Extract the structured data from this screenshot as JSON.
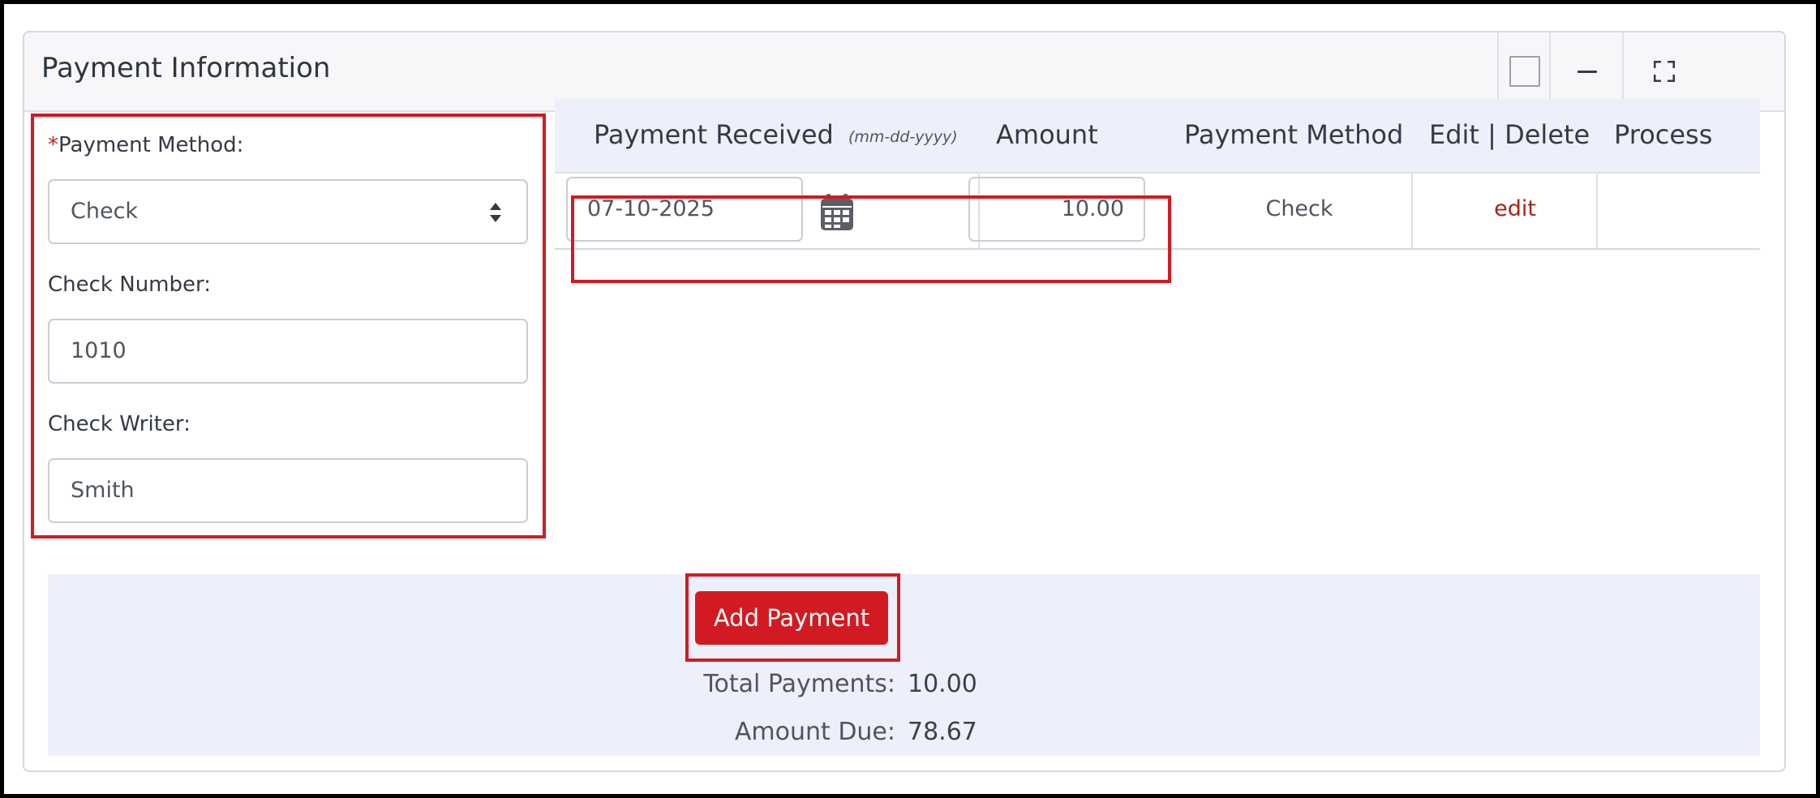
{
  "panel": {
    "title": "Payment Information",
    "controls": [
      "checkbox-square",
      "minimize",
      "fullscreen"
    ]
  },
  "form": {
    "payment_method": {
      "required_marker": "*",
      "label": "Payment Method:",
      "value": "Check"
    },
    "check_number": {
      "label": "Check Number:",
      "value": "1010"
    },
    "check_writer": {
      "label": "Check Writer:",
      "value": "Smith"
    }
  },
  "table": {
    "headers": {
      "payment_received": "Payment Received",
      "date_format": "(mm-dd-yyyy)",
      "amount": "Amount",
      "payment_method": "Payment Method",
      "edit_delete": "Edit | Delete",
      "process": "Process"
    },
    "row": {
      "date": "07-10-2025",
      "amount": "10.00",
      "method": "Check",
      "edit": "edit",
      "process": ""
    }
  },
  "footer": {
    "add_button": "Add Payment",
    "total_label": "Total Payments:",
    "total_value": "10.00",
    "due_label": "Amount Due:",
    "due_value": "78.67"
  },
  "colors": {
    "accent_red": "#d21a22",
    "link_red": "#a62218",
    "header_bg": "#f7f7f9",
    "table_header_bg": "#edf0fa"
  },
  "icons": [
    "sort-caret-icon",
    "calendar-icon",
    "minimize-icon",
    "fullscreen-icon"
  ]
}
